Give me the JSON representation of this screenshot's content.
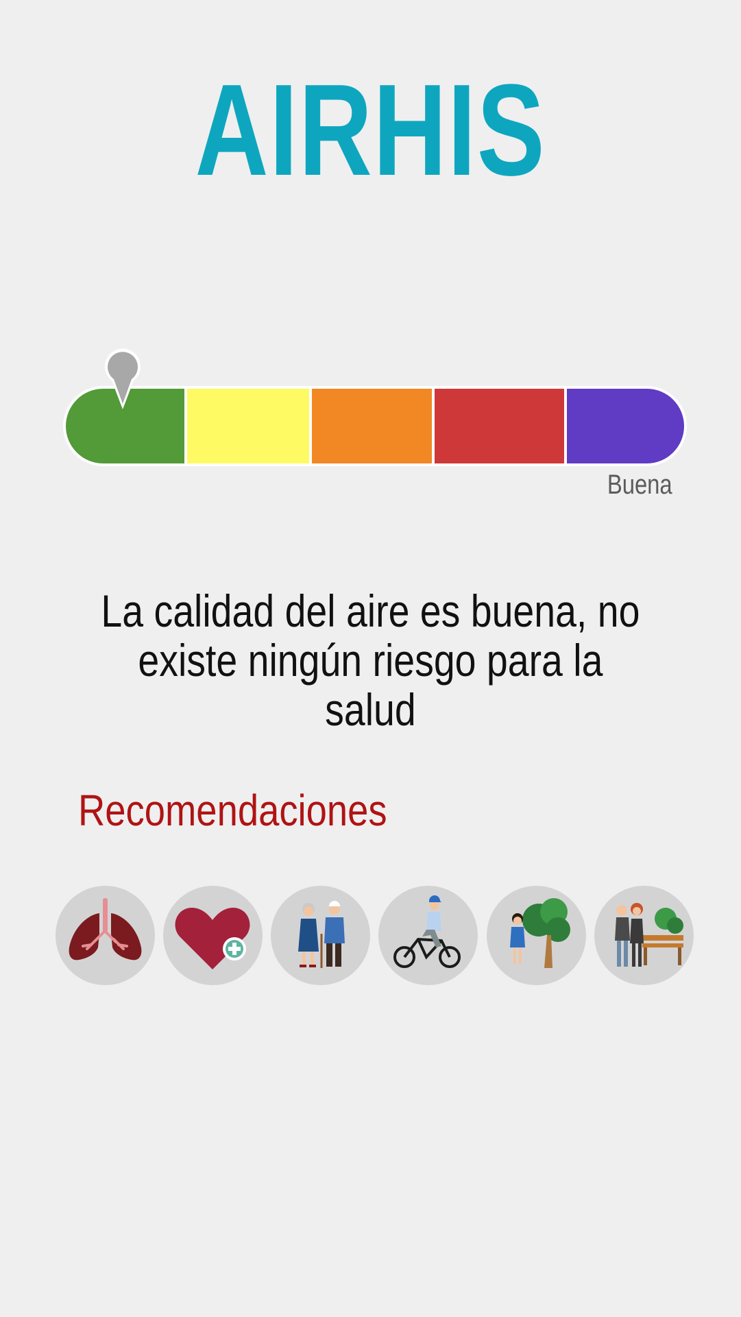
{
  "app": {
    "title": "AIRHIS"
  },
  "quality": {
    "level_index": 0,
    "level_label": "Buena",
    "message": "La calidad del aire es buena, no existe ningún riesgo para la salud",
    "scale_colors": [
      "#539a38",
      "#fefa64",
      "#f18824",
      "#ce3838",
      "#5f3cc3"
    ]
  },
  "recommendations": {
    "title": "Recomendaciones",
    "items": [
      {
        "icon": "lungs-icon"
      },
      {
        "icon": "heart-health-icon"
      },
      {
        "icon": "elderly-couple-icon"
      },
      {
        "icon": "cyclist-icon"
      },
      {
        "icon": "child-tree-icon"
      },
      {
        "icon": "couple-bench-icon"
      }
    ]
  },
  "colors": {
    "title": "#0ea6bf",
    "section_title": "#b01313",
    "pin": "#a8a8a8",
    "icon_background": "#d4d3d4"
  }
}
